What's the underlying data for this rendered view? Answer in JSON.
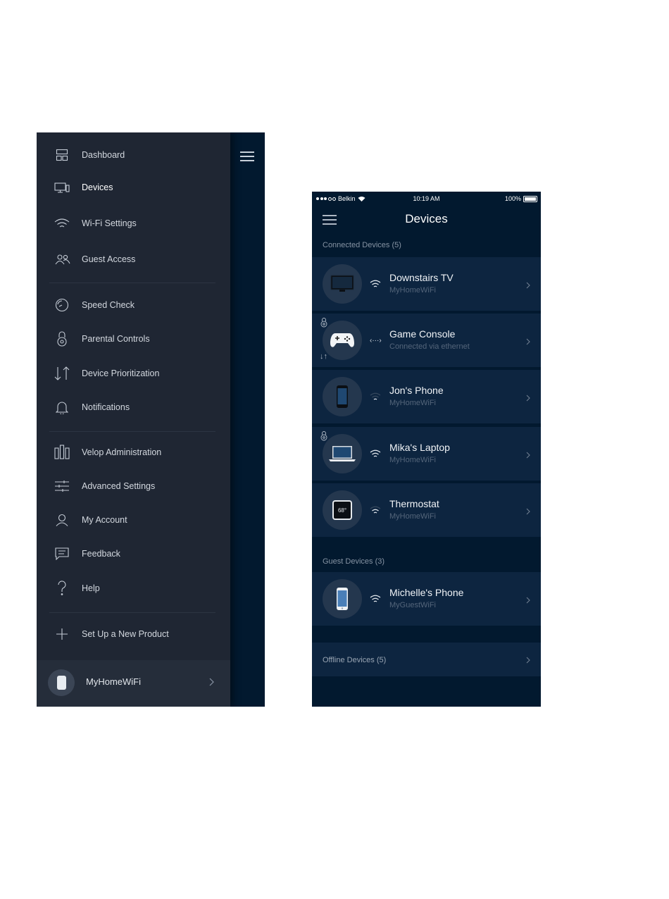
{
  "menu": {
    "items": [
      {
        "label": "Dashboard",
        "icon": "dashboard-icon"
      },
      {
        "label": "Devices",
        "icon": "devices-icon"
      },
      {
        "label": "Wi-Fi Settings",
        "icon": "wifi-icon"
      },
      {
        "label": "Guest Access",
        "icon": "guest-access-icon"
      },
      {
        "label": "Speed Check",
        "icon": "speedometer-icon"
      },
      {
        "label": "Parental Controls",
        "icon": "lock-icon"
      },
      {
        "label": "Device Prioritization",
        "icon": "priority-arrows-icon"
      },
      {
        "label": "Notifications",
        "icon": "bell-icon"
      },
      {
        "label": "Velop Administration",
        "icon": "velop-nodes-icon"
      },
      {
        "label": "Advanced Settings",
        "icon": "sliders-icon"
      },
      {
        "label": "My Account",
        "icon": "user-icon"
      },
      {
        "label": "Feedback",
        "icon": "chat-bubble-icon"
      },
      {
        "label": "Help",
        "icon": "question-icon"
      },
      {
        "label": "Set Up a New Product",
        "icon": "plus-icon"
      }
    ],
    "network_name": "MyHomeWiFi"
  },
  "status_bar": {
    "carrier": "Belkin",
    "time": "10:19 AM",
    "battery": "100%"
  },
  "devices_screen": {
    "title": "Devices",
    "connected_header": "Connected Devices (5)",
    "connected": [
      {
        "name": "Downstairs TV",
        "sub": "MyHomeWiFi",
        "icon": "tv-icon",
        "connection": "wifi",
        "parental": false,
        "priority": false
      },
      {
        "name": "Game Console",
        "sub": "Connected via ethernet",
        "icon": "gamepad-icon",
        "connection": "ethernet",
        "parental": true,
        "priority": true
      },
      {
        "name": "Jon's Phone",
        "sub": "MyHomeWiFi",
        "icon": "phone-icon",
        "connection": "wifi-weak",
        "parental": false,
        "priority": false
      },
      {
        "name": "Mika's Laptop",
        "sub": "MyHomeWiFi",
        "icon": "laptop-icon",
        "connection": "wifi",
        "parental": true,
        "priority": false
      },
      {
        "name": "Thermostat",
        "sub": "MyHomeWiFi",
        "icon": "thermostat-icon",
        "connection": "wifi-weak",
        "parental": false,
        "priority": false
      }
    ],
    "thermostat_display": "68°",
    "guest_header": "Guest Devices (3)",
    "guest": [
      {
        "name": "Michelle's Phone",
        "sub": "MyGuestWiFi",
        "icon": "phone-icon",
        "connection": "wifi"
      }
    ],
    "offline_label": "Offline Devices (5)"
  },
  "colors": {
    "drawer_bg": "#1f2633",
    "app_bg": "#02192f",
    "row_bg": "#0d2540",
    "text": "#f1f4f7",
    "subtext": "#54657a"
  }
}
